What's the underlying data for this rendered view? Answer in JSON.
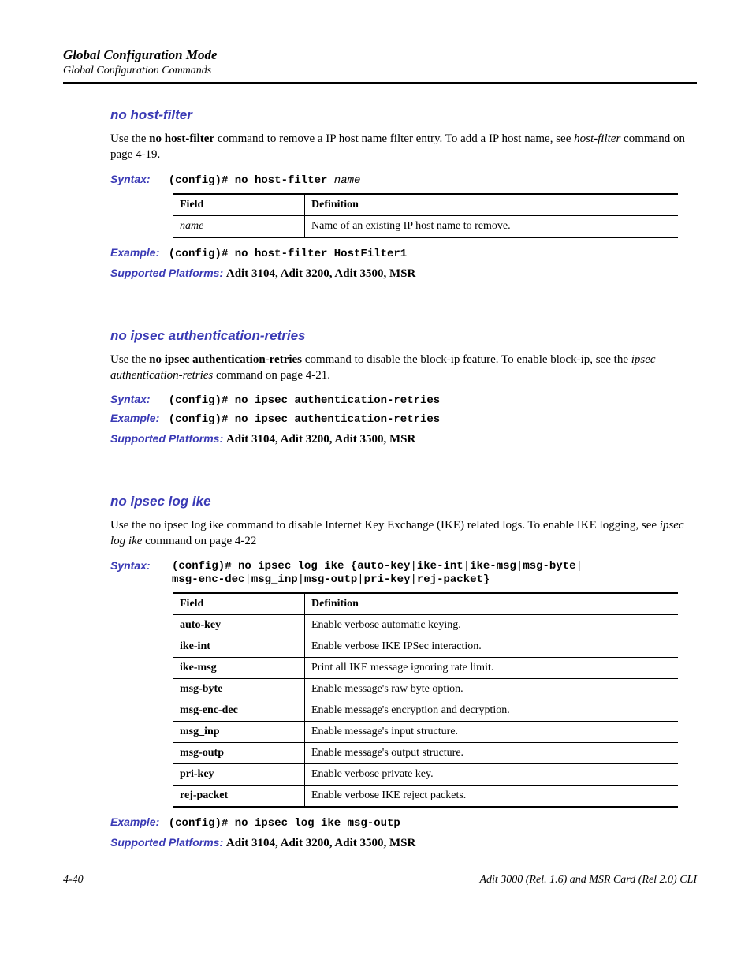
{
  "header": {
    "chapter": "Global Configuration Mode",
    "sub": "Global Configuration Commands"
  },
  "sections": {
    "host_filter": {
      "title": "no host-filter",
      "body_pre": "Use the ",
      "body_bold1": "no host-filter",
      "body_mid": " command to remove a IP host name filter entry. To add a IP host name, see ",
      "body_ital": "host-filter",
      "body_post": " command on page 4-19.",
      "syntax_label": "Syntax:",
      "syntax_cmd": "(config)# no host-filter ",
      "syntax_arg": "name",
      "table_h1": "Field",
      "table_h2": "Definition",
      "table_f1": "name",
      "table_d1": "Name of an existing IP host name to remove.",
      "example_label": "Example:",
      "example_cmd": "(config)# no host-filter HostFilter1",
      "platforms_label": "Supported Platforms:",
      "platforms_val": "Adit 3104, Adit 3200, Adit 3500, MSR"
    },
    "ipsec_auth": {
      "title": "no ipsec authentication-retries",
      "body_pre": "Use the ",
      "body_bold1": "no ipsec authentication-retries",
      "body_mid": " command to disable the block-ip feature. To enable block-ip, see the ",
      "body_ital": "ipsec authentication-retries",
      "body_post": " command on page 4-21.",
      "syntax_label": "Syntax:",
      "syntax_cmd": "(config)# no ipsec authentication-retries",
      "example_label": "Example:",
      "example_cmd": "(config)# no ipsec authentication-retries",
      "platforms_label": "Supported Platforms:",
      "platforms_val": "Adit 3104, Adit 3200, Adit 3500, MSR"
    },
    "ipsec_log": {
      "title": "no ipsec log ike",
      "body_pre": "Use the no ipsec log ike command to disable Internet Key Exchange (IKE) related logs. To enable IKE logging, see ",
      "body_ital": "ipsec log ike",
      "body_post": " command on page 4-22",
      "syntax_label": "Syntax:",
      "syntax_line1a": "(config)# no ipsec log ike {",
      "syntax_line1b": "auto-key",
      "syntax_line1c": "|",
      "syntax_line1d": "ike-int",
      "syntax_line1e": "|",
      "syntax_line1f": "ike-msg",
      "syntax_line1g": "|",
      "syntax_line1h": "msg-byte",
      "syntax_line1i": "|",
      "syntax_line2a": "msg-enc-dec",
      "syntax_line2b": "|",
      "syntax_line2c": "msg_inp",
      "syntax_line2d": "|",
      "syntax_line2e": "msg-outp",
      "syntax_line2f": "|",
      "syntax_line2g": "pri-key",
      "syntax_line2h": "|",
      "syntax_line2i": "rej-packet",
      "syntax_line2j": "}",
      "table_h1": "Field",
      "table_h2": "Definition",
      "rows": [
        {
          "f": "auto-key",
          "d": "Enable verbose automatic keying."
        },
        {
          "f": "ike-int",
          "d": "Enable verbose IKE IPSec interaction."
        },
        {
          "f": "ike-msg",
          "d": "Print all IKE message ignoring rate limit."
        },
        {
          "f": "msg-byte",
          "d": "Enable message's raw byte option."
        },
        {
          "f": "msg-enc-dec",
          "d": "Enable message's encryption and decryption."
        },
        {
          "f": "msg_inp",
          "d": "Enable message's input structure."
        },
        {
          "f": "msg-outp",
          "d": "Enable message's output structure."
        },
        {
          "f": "pri-key",
          "d": "Enable verbose private key."
        },
        {
          "f": "rej-packet",
          "d": "Enable verbose IKE reject packets."
        }
      ],
      "example_label": "Example:",
      "example_cmd": "(config)# no ipsec log ike msg-outp",
      "platforms_label": "Supported Platforms:",
      "platforms_val": "Adit 3104, Adit 3200, Adit 3500, MSR"
    }
  },
  "footer": {
    "page": "4-40",
    "doc": "Adit 3000 (Rel. 1.6) and MSR Card (Rel 2.0) CLI"
  }
}
